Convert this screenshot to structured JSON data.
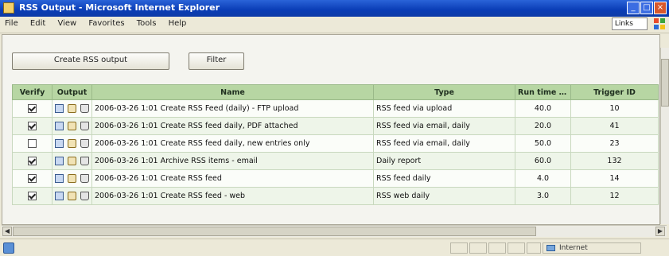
{
  "window": {
    "title": "RSS Output - Microsoft Internet Explorer"
  },
  "menubar": {
    "items": [
      "File",
      "Edit",
      "View",
      "Favorites",
      "Tools",
      "Help"
    ],
    "zoom_label": "Links"
  },
  "toolbar": {
    "add_label": "Create RSS output",
    "filter_label": "Filter"
  },
  "table": {
    "columns": [
      "Verify",
      "Output",
      "Name",
      "Type",
      "Run time (s)",
      "Trigger ID"
    ],
    "rows": [
      {
        "checked": true,
        "output": "2006-03-26 1:01",
        "name": "Create RSS Feed (daily) - FTP upload",
        "type": "RSS feed via upload",
        "runtime": "40.0",
        "trigger": "10"
      },
      {
        "checked": true,
        "output": "2006-03-26 1:01",
        "name": "Create RSS feed daily, PDF attached",
        "type": "RSS feed via email, daily",
        "runtime": "20.0",
        "trigger": "41"
      },
      {
        "checked": false,
        "output": "2006-03-26 1:01",
        "name": "Create RSS feed daily, new entries only",
        "type": "RSS feed via email, daily",
        "runtime": "50.0",
        "trigger": "23"
      },
      {
        "checked": true,
        "output": "2006-03-26 1:01",
        "name": "Archive RSS items - email",
        "type": "Daily report",
        "runtime": "60.0",
        "trigger": "132"
      },
      {
        "checked": true,
        "output": "2006-03-26 1:01",
        "name": "Create RSS feed",
        "type": "RSS feed daily",
        "runtime": "4.0",
        "trigger": "14"
      },
      {
        "checked": true,
        "output": "2006-03-26 1:01",
        "name": "Create RSS feed - web",
        "type": "RSS web daily",
        "runtime": "3.0",
        "trigger": "12"
      }
    ]
  },
  "statusbar": {
    "zone": "Internet"
  },
  "colors": {
    "header": "#b7d6a3",
    "title_bar": "#0a3db6"
  }
}
